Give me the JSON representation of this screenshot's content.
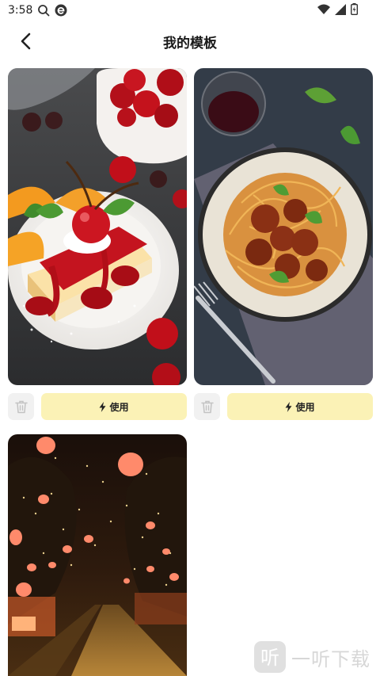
{
  "status_bar": {
    "time": "3:58",
    "left_icons": [
      "search-icon",
      "browser-e-icon"
    ],
    "right_icons": [
      "wifi-icon",
      "signal-icon",
      "battery-icon"
    ]
  },
  "header": {
    "title": "我的模板",
    "back_icon": "chevron-left-icon"
  },
  "templates": [
    {
      "image": "cherry cheesecake photo",
      "delete_icon": "trash-icon",
      "use_icon": "lightning-icon",
      "use_label": "使用"
    },
    {
      "image": "spaghetti meatballs photo",
      "delete_icon": "trash-icon",
      "use_icon": "lightning-icon",
      "use_label": "使用"
    },
    {
      "image": "lantern street night photo"
    }
  ],
  "watermark": {
    "icon": "ting-logo-icon",
    "text": "一听下载"
  },
  "colors": {
    "use_button_bg": "#fbf2b6",
    "delete_button_bg": "#f1f1f1"
  }
}
